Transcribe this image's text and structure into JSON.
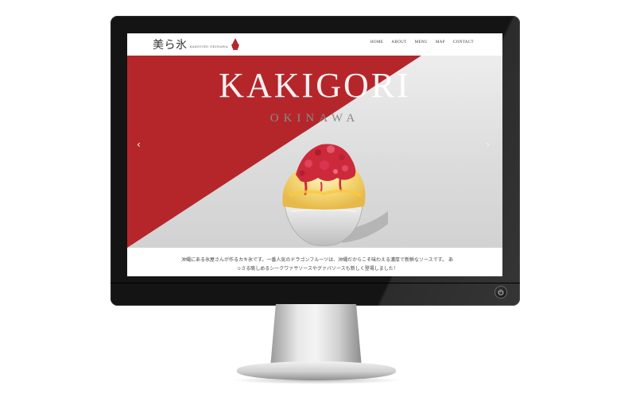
{
  "site": {
    "logo_text": "美ら氷",
    "logo_subtext": "KAKIGORI OKINAWA",
    "nav": [
      "HOME",
      "ABOUT",
      "MENU",
      "MAP",
      "CONTACT"
    ]
  },
  "hero": {
    "title": "KAKIGORI",
    "subtitle": "OKINAWA",
    "prev_arrow": "‹",
    "next_arrow": "›"
  },
  "caption": {
    "text": "沖縄にある氷屋さんが作るカキ氷です。一番人気のドラゴンフルーツは、沖縄だからこそ味わえる濃厚で新鮮なソースです。 あっさる眺しめるシークワァサソースやグァバソースも新しく登場しました！"
  },
  "colors": {
    "brand_red": "#b5262b",
    "text_dark": "#333333",
    "monitor_bezel": "#141414"
  },
  "icons": {
    "logo_icon": "kakigori-bowl-icon",
    "power": "power-icon"
  }
}
